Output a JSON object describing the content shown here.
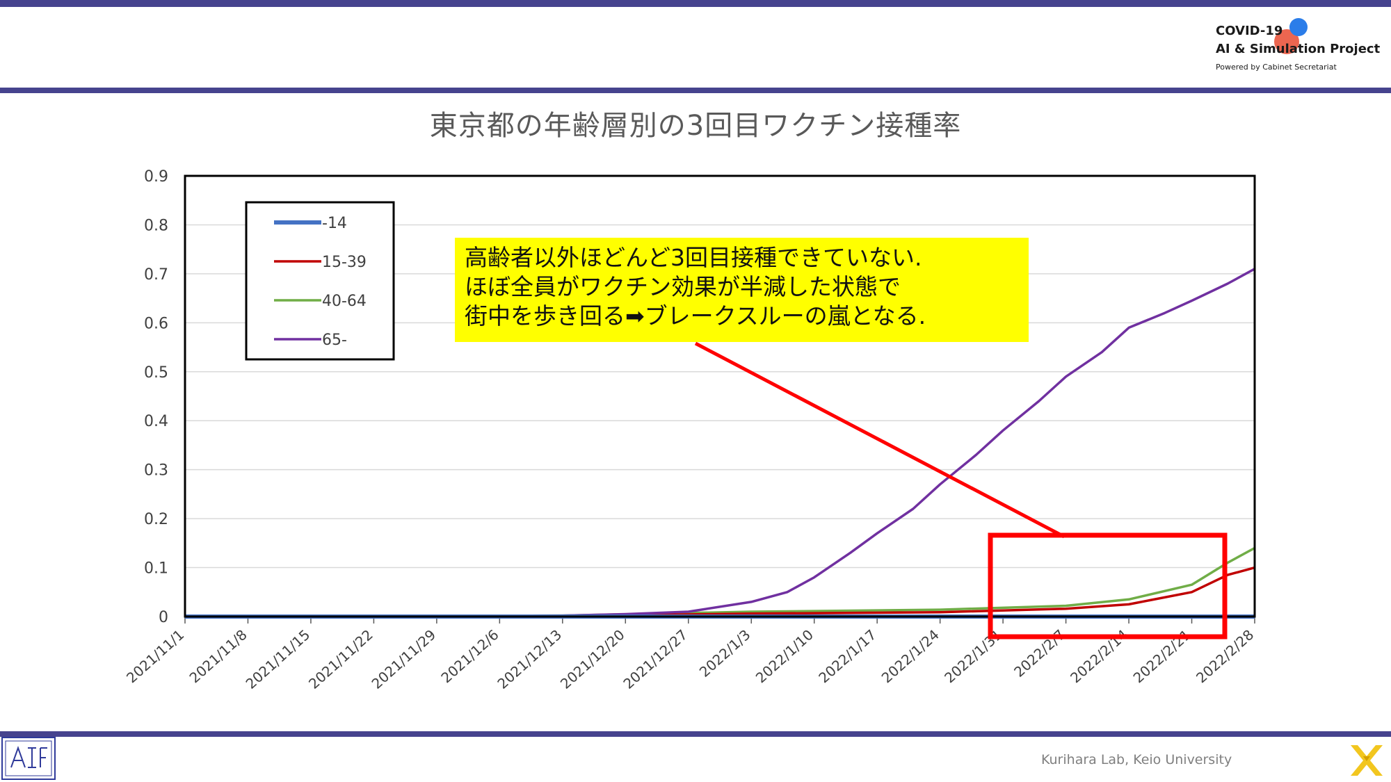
{
  "logo": {
    "line1": "COVID-19",
    "line2": "AI & Simulation Project",
    "line3": "Powered by Cabinet Secretariat"
  },
  "callout": {
    "line1": "高齢者以外ほどんど3回目接種できていない.",
    "line2": "ほぼ全員がワクチン効果が半減した状態で",
    "line3": "街中を歩き回る➡ブレークスルーの嵐となる."
  },
  "footer": {
    "credit": "Kurihara Lab, Keio University"
  },
  "colors": {
    "band": "#46438e",
    "callout": "#ffff00",
    "highlight": "#ff0000"
  },
  "chart_data": {
    "type": "line",
    "title": "東京都の年齢層別の3回目ワクチン接種率",
    "xlabel": "",
    "ylabel": "",
    "ylim": [
      0,
      0.9
    ],
    "yticks": [
      "0",
      "0.1",
      "0.2",
      "0.3",
      "0.4",
      "0.5",
      "0.6",
      "0.7",
      "0.8",
      "0.9"
    ],
    "ytick_values": [
      0,
      0.1,
      0.2,
      0.3,
      0.4,
      0.5,
      0.6,
      0.7,
      0.8,
      0.9
    ],
    "xticks": [
      "2021/11/1",
      "2021/11/8",
      "2021/11/15",
      "2021/11/22",
      "2021/11/29",
      "2021/12/6",
      "2021/12/13",
      "2021/12/20",
      "2021/12/27",
      "2022/1/3",
      "2022/1/10",
      "2022/1/17",
      "2022/1/24",
      "2022/1/31",
      "2022/2/7",
      "2022/2/14",
      "2022/2/21",
      "2022/2/28"
    ],
    "x_start": "2021/11/1",
    "x_end": "2022/2/28",
    "grid": "horizontal",
    "legend_position": "top-left",
    "series": [
      {
        "name": "-14",
        "color": "#4472c4",
        "x": [
          "2021/11/1",
          "2022/2/28"
        ],
        "y": [
          0,
          0
        ]
      },
      {
        "name": "15-39",
        "color": "#c00000",
        "x": [
          "2021/11/1",
          "2021/12/13",
          "2022/1/3",
          "2022/1/24",
          "2022/2/7",
          "2022/2/14",
          "2022/2/21",
          "2022/2/25",
          "2022/2/28"
        ],
        "y": [
          0,
          0.001,
          0.006,
          0.009,
          0.016,
          0.025,
          0.05,
          0.085,
          0.1
        ]
      },
      {
        "name": "40-64",
        "color": "#70ad47",
        "x": [
          "2021/11/1",
          "2021/12/13",
          "2022/1/3",
          "2022/1/24",
          "2022/2/7",
          "2022/2/14",
          "2022/2/21",
          "2022/2/25",
          "2022/2/28"
        ],
        "y": [
          0,
          0.002,
          0.01,
          0.014,
          0.022,
          0.035,
          0.065,
          0.11,
          0.14
        ]
      },
      {
        "name": "65-",
        "color": "#7030a0",
        "x": [
          "2021/11/1",
          "2021/12/13",
          "2021/12/20",
          "2021/12/27",
          "2022/1/3",
          "2022/1/7",
          "2022/1/10",
          "2022/1/14",
          "2022/1/17",
          "2022/1/21",
          "2022/1/24",
          "2022/1/28",
          "2022/1/31",
          "2022/2/4",
          "2022/2/7",
          "2022/2/11",
          "2022/2/14",
          "2022/2/18",
          "2022/2/21",
          "2022/2/25",
          "2022/2/28"
        ],
        "y": [
          0,
          0.002,
          0.005,
          0.01,
          0.03,
          0.05,
          0.08,
          0.13,
          0.17,
          0.22,
          0.27,
          0.33,
          0.38,
          0.44,
          0.49,
          0.54,
          0.59,
          0.62,
          0.645,
          0.68,
          0.71
        ]
      }
    ]
  }
}
